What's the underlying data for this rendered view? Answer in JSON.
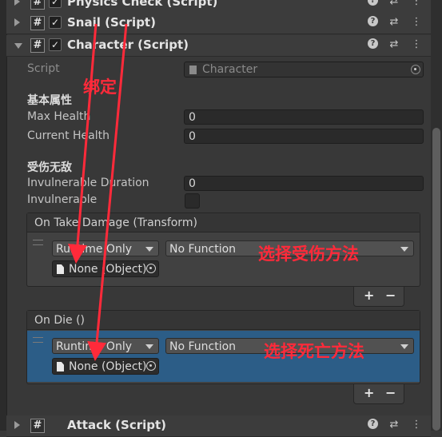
{
  "components": {
    "physics": {
      "title": "Physics Check (Script)"
    },
    "snail": {
      "title": "Snail (Script)"
    },
    "character": {
      "title": "Character (Script)"
    },
    "attack": {
      "title": "Attack (Script)"
    }
  },
  "header_icons": {
    "help": "?",
    "settings": "⇄",
    "more": "⋮"
  },
  "script_field": {
    "label": "Script",
    "value": "Character"
  },
  "sections": {
    "basic": "基本属性",
    "invulnerable": "受伤无敌"
  },
  "fields": {
    "max_health": {
      "label": "Max Health",
      "value": "0"
    },
    "current_health": {
      "label": "Current Health",
      "value": "0"
    },
    "invulnerable_duration": {
      "label": "Invulnerable Duration",
      "value": "0"
    },
    "invulnerable": {
      "label": "Invulnerable",
      "checked": false
    }
  },
  "events": {
    "on_take_damage": {
      "title": "On Take Damage (Transform)",
      "runtime": "Runtime Only",
      "function": "No Function",
      "object": "None (Object)"
    },
    "on_die": {
      "title": "On Die ()",
      "runtime": "Runtime Only",
      "function": "No Function",
      "object": "None (Object)"
    },
    "plus": "+",
    "minus": "−"
  },
  "annotations": {
    "bind": "绑定",
    "choose_damage": "选择受伤方法",
    "choose_death": "选择死亡方法",
    "color": "#ff2a3a"
  }
}
